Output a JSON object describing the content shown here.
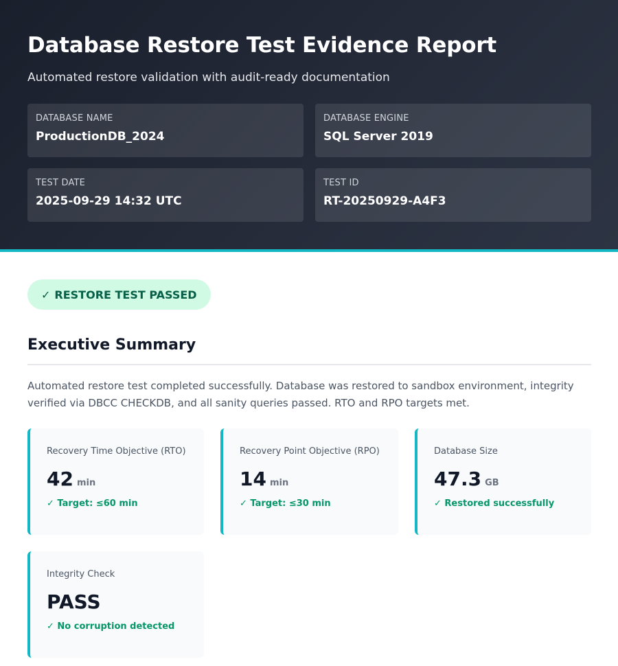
{
  "report": {
    "title": "Database Restore Test Evidence Report",
    "subtitle": "Automated restore validation with audit-ready documentation"
  },
  "meta": [
    {
      "label": "DATABASE NAME",
      "value": "ProductionDB_2024"
    },
    {
      "label": "DATABASE ENGINE",
      "value": "SQL Server 2019"
    },
    {
      "label": "TEST DATE",
      "value": "2025-09-29 14:32 UTC"
    },
    {
      "label": "TEST ID",
      "value": "RT-20250929-A4F3"
    }
  ],
  "status": {
    "icon": "check-icon",
    "check": "✓",
    "label": "RESTORE TEST PASSED",
    "color": "#065f46",
    "background": "#d1fae5"
  },
  "summary": {
    "heading": "Executive Summary",
    "text": "Automated restore test completed successfully. Database was restored to sandbox environment, integrity verified via DBCC CHECKDB, and all sanity queries passed. RTO and RPO targets met."
  },
  "metrics": [
    {
      "label": "Recovery Time Objective (RTO)",
      "value": "42",
      "unit": "min",
      "note": "✓ Target: ≤60 min"
    },
    {
      "label": "Recovery Point Objective (RPO)",
      "value": "14",
      "unit": "min",
      "note": "✓ Target: ≤30 min"
    },
    {
      "label": "Database Size",
      "value": "47.3",
      "unit": "GB",
      "note": "✓ Restored successfully"
    },
    {
      "label": "Integrity Check",
      "value": "PASS",
      "unit": "",
      "note": "✓ No corruption detected"
    }
  ],
  "colors": {
    "header_bg": "#1a1f2c",
    "accent": "#14b8c4",
    "success": "#059669"
  }
}
